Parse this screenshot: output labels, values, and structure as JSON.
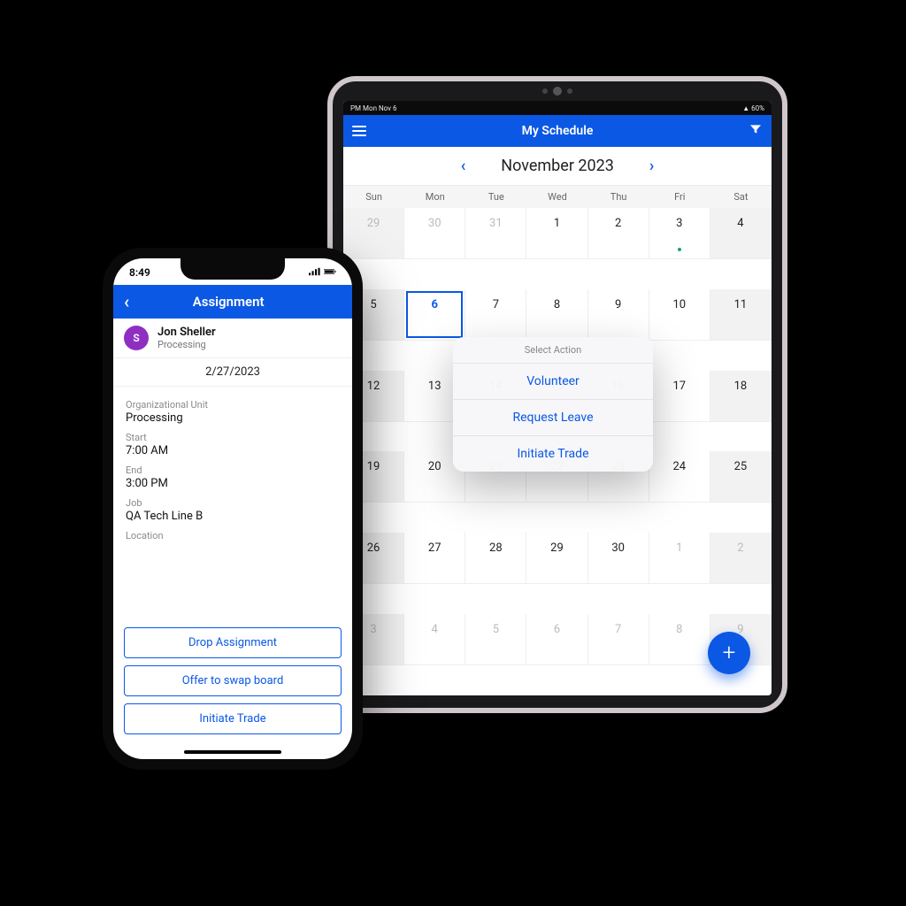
{
  "tablet": {
    "status": {
      "left": "PM  Mon Nov 6",
      "right": "60%"
    },
    "title": "My Schedule",
    "month_label": "November 2023",
    "dow": [
      "Sun",
      "Mon",
      "Tue",
      "Wed",
      "Thu",
      "Fri",
      "Sat"
    ],
    "weeks": [
      [
        {
          "n": "29",
          "dim": true,
          "we": true
        },
        {
          "n": "30",
          "dim": true
        },
        {
          "n": "31",
          "dim": true
        },
        {
          "n": "1"
        },
        {
          "n": "2"
        },
        {
          "n": "3",
          "dot": true
        },
        {
          "n": "4",
          "we": true
        }
      ],
      [
        {
          "n": "5",
          "we": true
        },
        {
          "n": "6",
          "sel": true
        },
        {
          "n": "7"
        },
        {
          "n": "8"
        },
        {
          "n": "9"
        },
        {
          "n": "10"
        },
        {
          "n": "11",
          "we": true
        }
      ],
      [
        {
          "n": "12",
          "we": true
        },
        {
          "n": "13"
        },
        {
          "n": "14"
        },
        {
          "n": "15"
        },
        {
          "n": "16"
        },
        {
          "n": "17"
        },
        {
          "n": "18",
          "we": true
        }
      ],
      [
        {
          "n": "19",
          "we": true
        },
        {
          "n": "20"
        },
        {
          "n": "21"
        },
        {
          "n": "22"
        },
        {
          "n": "23"
        },
        {
          "n": "24"
        },
        {
          "n": "25",
          "we": true
        }
      ],
      [
        {
          "n": "26",
          "we": true
        },
        {
          "n": "27"
        },
        {
          "n": "28"
        },
        {
          "n": "29"
        },
        {
          "n": "30"
        },
        {
          "n": "1",
          "dim": true
        },
        {
          "n": "2",
          "dim": true,
          "we": true
        }
      ],
      [
        {
          "n": "3",
          "dim": true,
          "we": true
        },
        {
          "n": "4",
          "dim": true
        },
        {
          "n": "5",
          "dim": true
        },
        {
          "n": "6",
          "dim": true
        },
        {
          "n": "7",
          "dim": true
        },
        {
          "n": "8",
          "dim": true
        },
        {
          "n": "9",
          "dim": true,
          "we": true
        }
      ]
    ],
    "sheet": {
      "title": "Select Action",
      "items": [
        "Volunteer",
        "Request Leave",
        "Initiate Trade"
      ]
    },
    "fab": "+"
  },
  "phone": {
    "status_time": "8:49",
    "title": "Assignment",
    "user": {
      "initial": "S",
      "name": "Jon Sheller",
      "role": "Processing"
    },
    "date": "2/27/2023",
    "fields": {
      "org_label": "Organizational Unit",
      "org_value": "Processing",
      "start_label": "Start",
      "start_value": "7:00 AM",
      "end_label": "End",
      "end_value": "3:00 PM",
      "job_label": "Job",
      "job_value": "QA Tech Line B",
      "location_label": "Location"
    },
    "actions": [
      "Drop Assignment",
      "Offer to swap board",
      "Initiate Trade"
    ]
  }
}
